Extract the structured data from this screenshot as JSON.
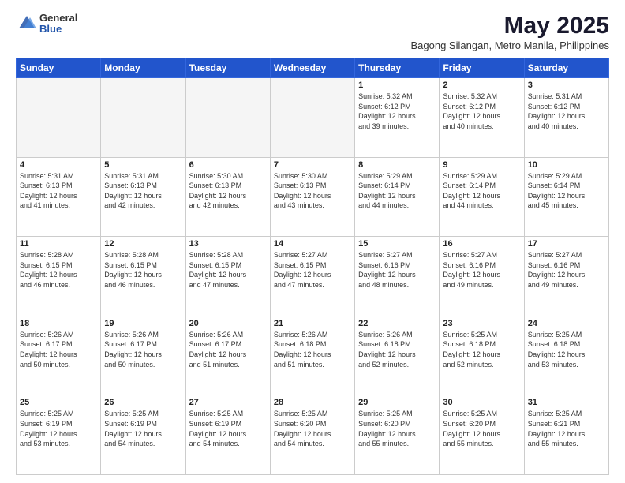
{
  "logo": {
    "general": "General",
    "blue": "Blue"
  },
  "title": "May 2025",
  "subtitle": "Bagong Silangan, Metro Manila, Philippines",
  "days_header": [
    "Sunday",
    "Monday",
    "Tuesday",
    "Wednesday",
    "Thursday",
    "Friday",
    "Saturday"
  ],
  "weeks": [
    [
      {
        "day": "",
        "info": ""
      },
      {
        "day": "",
        "info": ""
      },
      {
        "day": "",
        "info": ""
      },
      {
        "day": "",
        "info": ""
      },
      {
        "day": "1",
        "info": "Sunrise: 5:32 AM\nSunset: 6:12 PM\nDaylight: 12 hours\nand 39 minutes."
      },
      {
        "day": "2",
        "info": "Sunrise: 5:32 AM\nSunset: 6:12 PM\nDaylight: 12 hours\nand 40 minutes."
      },
      {
        "day": "3",
        "info": "Sunrise: 5:31 AM\nSunset: 6:12 PM\nDaylight: 12 hours\nand 40 minutes."
      }
    ],
    [
      {
        "day": "4",
        "info": "Sunrise: 5:31 AM\nSunset: 6:13 PM\nDaylight: 12 hours\nand 41 minutes."
      },
      {
        "day": "5",
        "info": "Sunrise: 5:31 AM\nSunset: 6:13 PM\nDaylight: 12 hours\nand 42 minutes."
      },
      {
        "day": "6",
        "info": "Sunrise: 5:30 AM\nSunset: 6:13 PM\nDaylight: 12 hours\nand 42 minutes."
      },
      {
        "day": "7",
        "info": "Sunrise: 5:30 AM\nSunset: 6:13 PM\nDaylight: 12 hours\nand 43 minutes."
      },
      {
        "day": "8",
        "info": "Sunrise: 5:29 AM\nSunset: 6:14 PM\nDaylight: 12 hours\nand 44 minutes."
      },
      {
        "day": "9",
        "info": "Sunrise: 5:29 AM\nSunset: 6:14 PM\nDaylight: 12 hours\nand 44 minutes."
      },
      {
        "day": "10",
        "info": "Sunrise: 5:29 AM\nSunset: 6:14 PM\nDaylight: 12 hours\nand 45 minutes."
      }
    ],
    [
      {
        "day": "11",
        "info": "Sunrise: 5:28 AM\nSunset: 6:15 PM\nDaylight: 12 hours\nand 46 minutes."
      },
      {
        "day": "12",
        "info": "Sunrise: 5:28 AM\nSunset: 6:15 PM\nDaylight: 12 hours\nand 46 minutes."
      },
      {
        "day": "13",
        "info": "Sunrise: 5:28 AM\nSunset: 6:15 PM\nDaylight: 12 hours\nand 47 minutes."
      },
      {
        "day": "14",
        "info": "Sunrise: 5:27 AM\nSunset: 6:15 PM\nDaylight: 12 hours\nand 47 minutes."
      },
      {
        "day": "15",
        "info": "Sunrise: 5:27 AM\nSunset: 6:16 PM\nDaylight: 12 hours\nand 48 minutes."
      },
      {
        "day": "16",
        "info": "Sunrise: 5:27 AM\nSunset: 6:16 PM\nDaylight: 12 hours\nand 49 minutes."
      },
      {
        "day": "17",
        "info": "Sunrise: 5:27 AM\nSunset: 6:16 PM\nDaylight: 12 hours\nand 49 minutes."
      }
    ],
    [
      {
        "day": "18",
        "info": "Sunrise: 5:26 AM\nSunset: 6:17 PM\nDaylight: 12 hours\nand 50 minutes."
      },
      {
        "day": "19",
        "info": "Sunrise: 5:26 AM\nSunset: 6:17 PM\nDaylight: 12 hours\nand 50 minutes."
      },
      {
        "day": "20",
        "info": "Sunrise: 5:26 AM\nSunset: 6:17 PM\nDaylight: 12 hours\nand 51 minutes."
      },
      {
        "day": "21",
        "info": "Sunrise: 5:26 AM\nSunset: 6:18 PM\nDaylight: 12 hours\nand 51 minutes."
      },
      {
        "day": "22",
        "info": "Sunrise: 5:26 AM\nSunset: 6:18 PM\nDaylight: 12 hours\nand 52 minutes."
      },
      {
        "day": "23",
        "info": "Sunrise: 5:25 AM\nSunset: 6:18 PM\nDaylight: 12 hours\nand 52 minutes."
      },
      {
        "day": "24",
        "info": "Sunrise: 5:25 AM\nSunset: 6:18 PM\nDaylight: 12 hours\nand 53 minutes."
      }
    ],
    [
      {
        "day": "25",
        "info": "Sunrise: 5:25 AM\nSunset: 6:19 PM\nDaylight: 12 hours\nand 53 minutes."
      },
      {
        "day": "26",
        "info": "Sunrise: 5:25 AM\nSunset: 6:19 PM\nDaylight: 12 hours\nand 54 minutes."
      },
      {
        "day": "27",
        "info": "Sunrise: 5:25 AM\nSunset: 6:19 PM\nDaylight: 12 hours\nand 54 minutes."
      },
      {
        "day": "28",
        "info": "Sunrise: 5:25 AM\nSunset: 6:20 PM\nDaylight: 12 hours\nand 54 minutes."
      },
      {
        "day": "29",
        "info": "Sunrise: 5:25 AM\nSunset: 6:20 PM\nDaylight: 12 hours\nand 55 minutes."
      },
      {
        "day": "30",
        "info": "Sunrise: 5:25 AM\nSunset: 6:20 PM\nDaylight: 12 hours\nand 55 minutes."
      },
      {
        "day": "31",
        "info": "Sunrise: 5:25 AM\nSunset: 6:21 PM\nDaylight: 12 hours\nand 55 minutes."
      }
    ]
  ]
}
